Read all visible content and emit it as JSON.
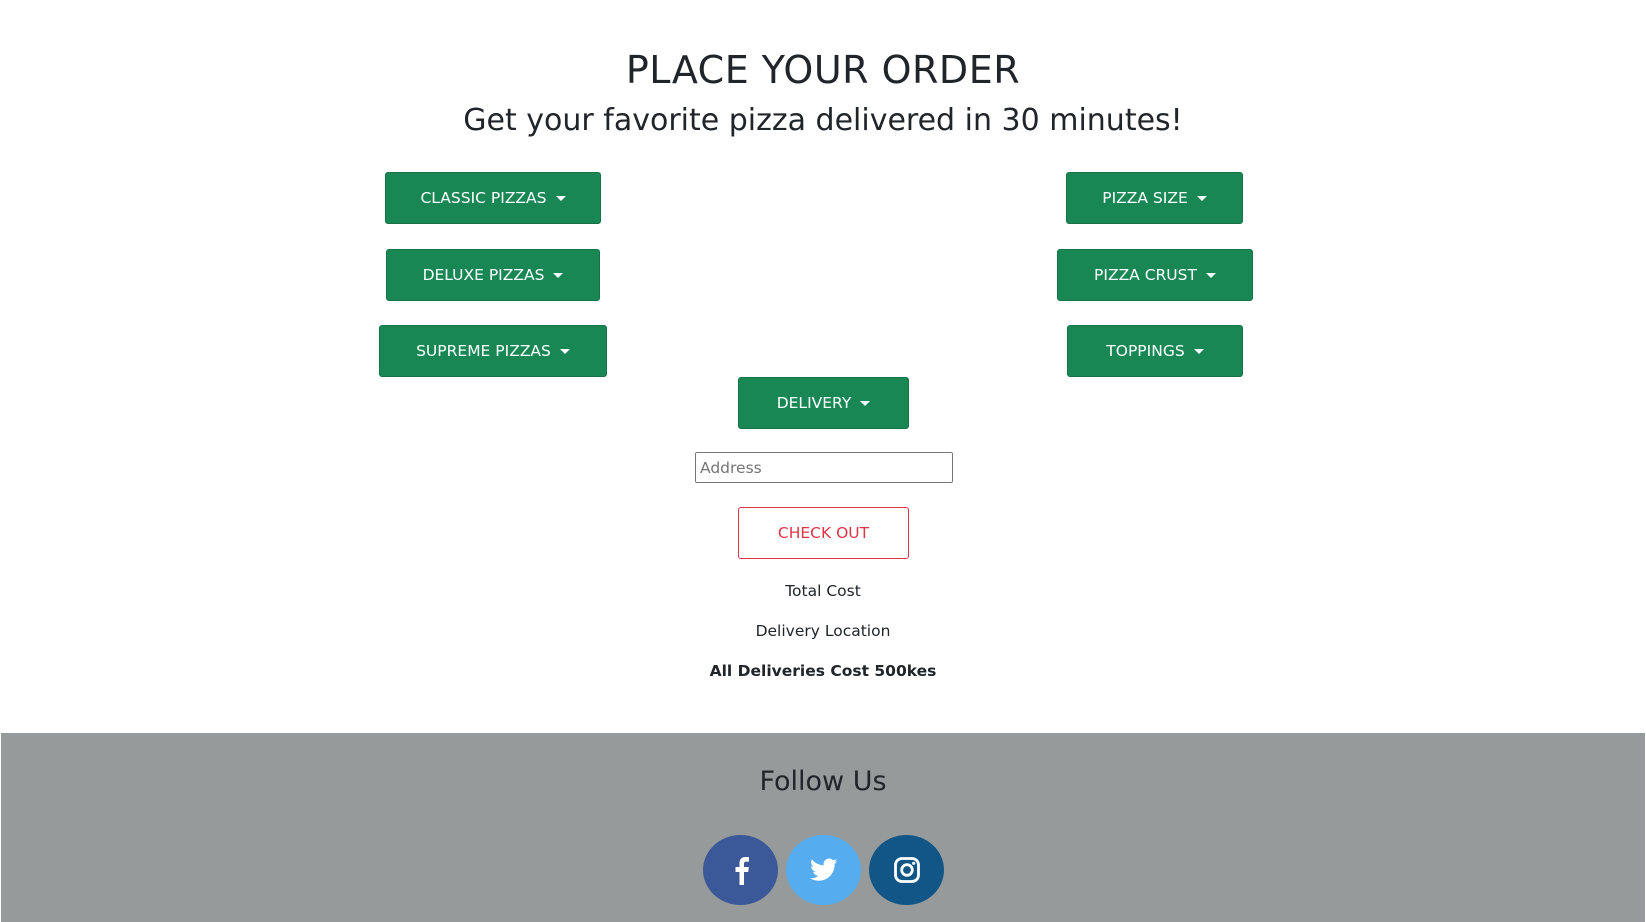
{
  "header": {
    "title": "PLACE YOUR ORDER",
    "subtitle": "Get your favorite pizza delivered in 30 minutes!"
  },
  "menu": {
    "classic_pizzas": "CLASSIC PIZZAS",
    "deluxe_pizzas": "DELUXE PIZZAS",
    "supreme_pizzas": "SUPREME PIZZAS",
    "pizza_size": "PIZZA SIZE",
    "pizza_crust": "PIZZA CRUST",
    "toppings": "TOPPINGS",
    "delivery": "DELIVERY"
  },
  "address": {
    "placeholder": "Address",
    "value": ""
  },
  "checkout": {
    "label": "CHECK OUT"
  },
  "summary": {
    "total_cost": "Total Cost",
    "delivery_location": "Delivery Location",
    "delivery_note": "All Deliveries Cost 500kes"
  },
  "footer": {
    "title": "Follow Us",
    "social": [
      {
        "icon": "facebook-icon",
        "color": "#3b5998"
      },
      {
        "icon": "twitter-icon",
        "color": "#55acee"
      },
      {
        "icon": "instagram-icon",
        "color": "#125688"
      }
    ]
  },
  "colors": {
    "primary": "#198754",
    "danger": "#dc3545",
    "footer_bg": "#969a9b"
  }
}
